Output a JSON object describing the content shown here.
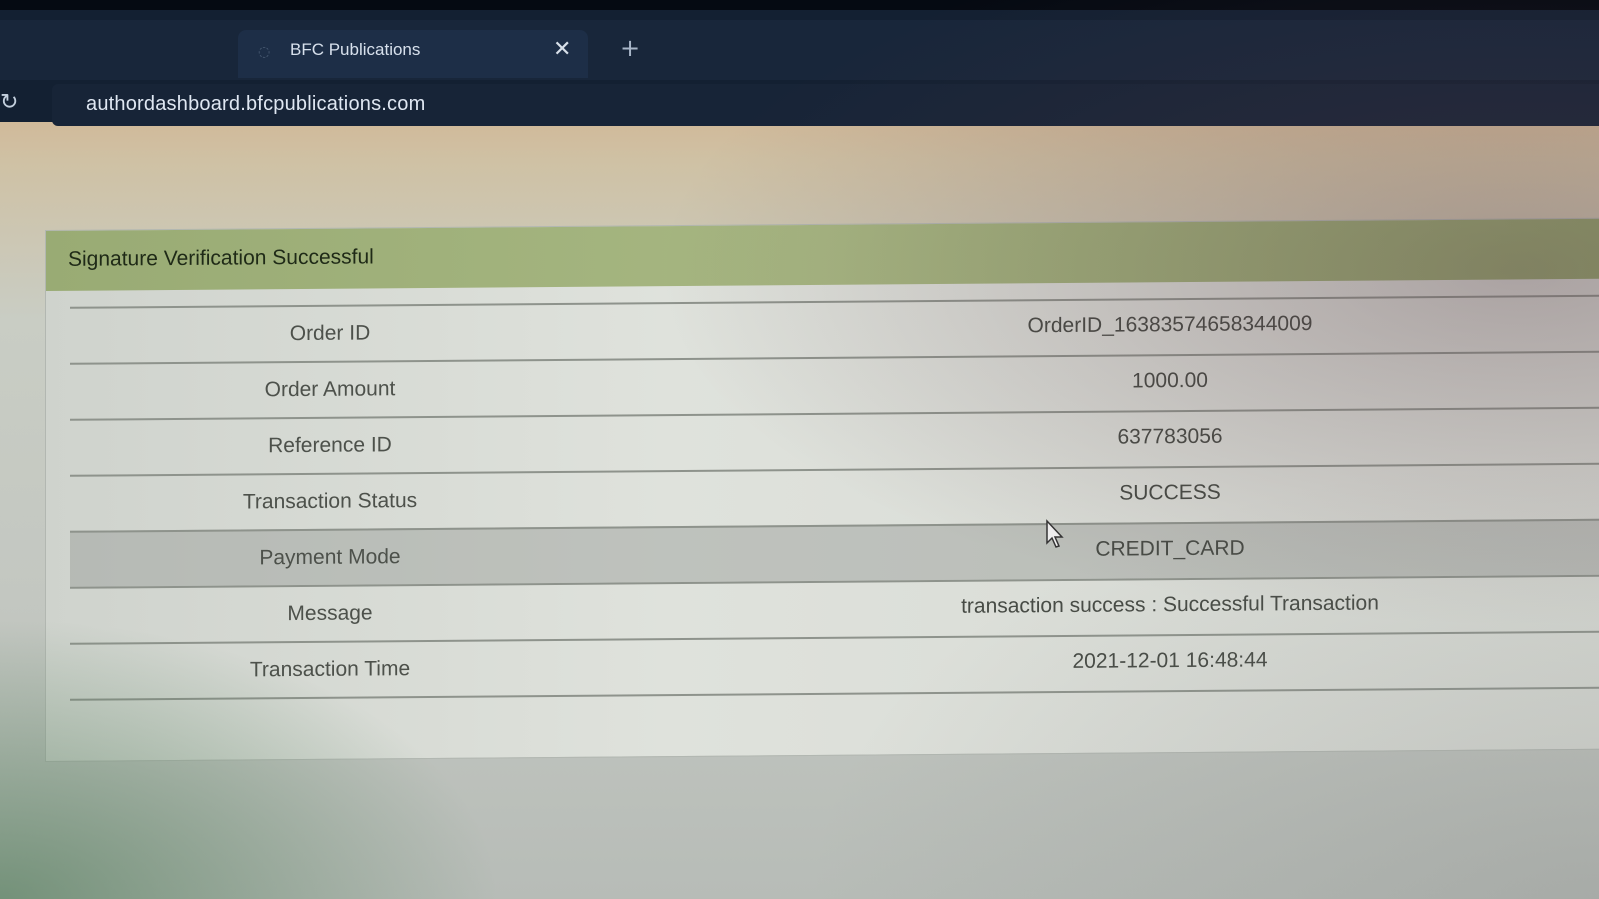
{
  "browser": {
    "tabs": [
      {
        "label": "",
        "active": false
      },
      {
        "label": "BFC Publications",
        "active": true
      }
    ],
    "close_glyph": "✕",
    "new_tab_glyph": "+",
    "reload_icon": "↻",
    "address": "authordashboard.bfcpublications.com"
  },
  "panel": {
    "title": "Signature Verification Successful",
    "header_color": "#a0b27b",
    "rows": [
      {
        "label": "Order ID",
        "value": "OrderID_1638357465834400‍9"
      },
      {
        "label": "Order Amount",
        "value": "1000.00"
      },
      {
        "label": "Reference ID",
        "value": "637783056"
      },
      {
        "label": "Transaction Status",
        "value": "SUCCESS"
      },
      {
        "label": "Payment Mode",
        "value": "CREDIT_CARD"
      },
      {
        "label": "Message",
        "value": "transaction success : Successful Transaction"
      },
      {
        "label": "Transaction Time",
        "value": "2021-12-01 16:48:44"
      }
    ]
  }
}
